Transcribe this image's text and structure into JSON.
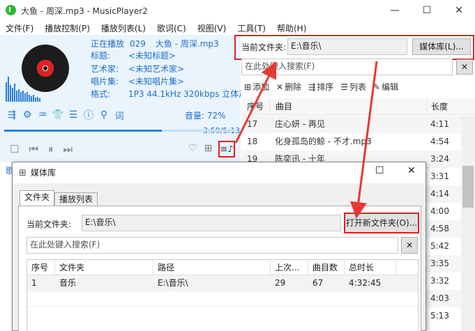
{
  "window": {
    "title": "大鱼 - 周深.mp3 - MusicPlayer2",
    "minimize": "—",
    "maximize": "☐",
    "close": "✕"
  },
  "menu": [
    "文件(F)",
    "播放控制(P)",
    "播放列表(L)",
    "歌词(C)",
    "视图(V)",
    "工具(T)",
    "帮助(H)"
  ],
  "player": {
    "now_playing_label": "正在播放",
    "track_number": "029",
    "now_playing": "大鱼 - 周深.mp3",
    "title_label": "标题:",
    "title": "<未知标题>",
    "artist_label": "艺术家:",
    "artist": "<未知艺术家>",
    "album_label": "唱片集:",
    "album": "<未知唱片集>",
    "format_label": "格式:",
    "format": "1P3 44.1kHz 320kbps 立体声",
    "lyrics_icon_label": "词",
    "volume": "音量: 72%",
    "time": "3:59/5:13",
    "progress_fraction": 0.68,
    "side_label": "歌"
  },
  "folder_bar": {
    "label": "当前文件夹:",
    "path": "E:\\音乐\\",
    "media_lib_button": "媒体库(L)..."
  },
  "playlist_search": {
    "placeholder": "在此处键入搜索(F)",
    "clear": "✕"
  },
  "playlist_toolbar": {
    "add": "添加",
    "delete": "删除",
    "sort": "排序",
    "list": "列表",
    "edit": "编辑"
  },
  "playlist": {
    "col_no": "序号",
    "col_title": "曲目",
    "col_len": "长度",
    "rows": [
      {
        "no": "17",
        "title": "庄心妍 - 再见",
        "len": "4:11"
      },
      {
        "no": "18",
        "title": "化身孤岛的鲸 - 不才.mp3",
        "len": "4:54"
      },
      {
        "no": "19",
        "title": "陈奕迅 - 十年",
        "len": "3:24"
      },
      {
        "no": "",
        "title": "",
        "len": "3:31"
      },
      {
        "no": "",
        "title": "",
        "len": "4:14"
      },
      {
        "no": "",
        "title": "",
        "len": "4:00"
      },
      {
        "no": "",
        "title": "",
        "len": "4:58"
      },
      {
        "no": "",
        "title": "",
        "len": "5:42"
      },
      {
        "no": "",
        "title": "",
        "len": "3:35"
      },
      {
        "no": "",
        "title": "",
        "len": "3:32"
      },
      {
        "no": "",
        "title": "",
        "len": "4:03"
      },
      {
        "no": "",
        "title": "",
        "len": "5:13"
      }
    ]
  },
  "dialog": {
    "title": "媒体库",
    "maximize": "☐",
    "close": "✕",
    "tab_folder": "文件夹",
    "tab_playlist": "播放列表",
    "folder_label": "当前文件夹:",
    "folder_path": "E:\\音乐\\",
    "open_button": "打开新文件夹(O)...",
    "search_placeholder": "在此处键入搜索(F)",
    "search_clear": "✕",
    "columns": [
      "序号",
      "文件夹",
      "路径",
      "上次...",
      "曲目数",
      "总时长"
    ],
    "rows": [
      {
        "no": "1",
        "folder": "音乐",
        "path": "E:\\音乐\\",
        "last": "29",
        "count": "67",
        "total": "4:32:45"
      }
    ]
  },
  "colors": {
    "accent": "#1e6fc8",
    "highlight": "#e02020",
    "player_bg": "#eaf4fd"
  }
}
